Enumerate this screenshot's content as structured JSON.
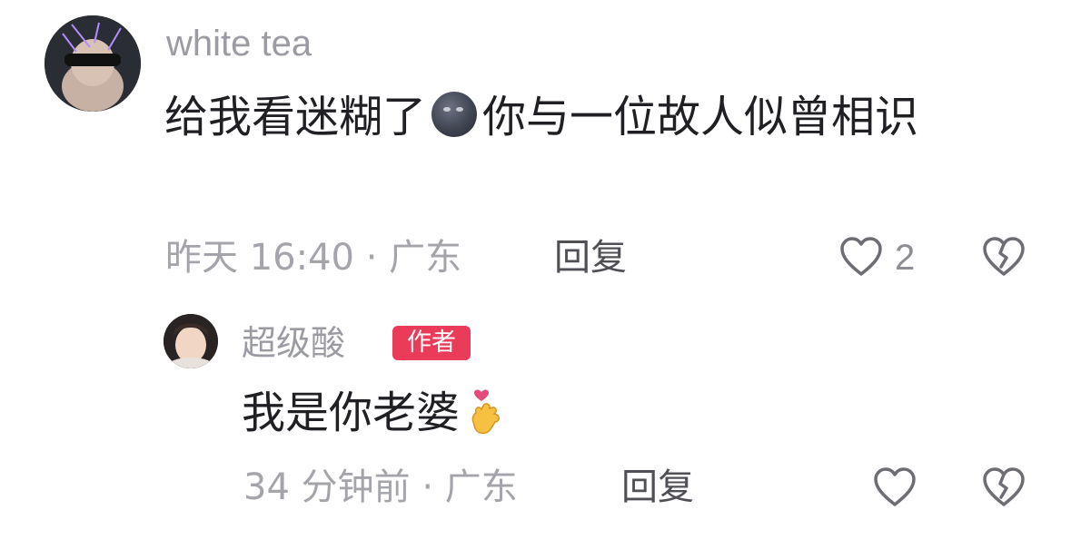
{
  "comment": {
    "username": "white tea",
    "text_before_emoji": "给我看迷糊了",
    "emoji": "new-moon-face-emoji",
    "text_after_emoji": "你与一位故人似曾相识",
    "time_location": "昨天 16:40 · 广东",
    "reply_label": "回复",
    "like_count": "2"
  },
  "reply": {
    "username": "超级酸",
    "badge": "作者",
    "text": "我是你老婆",
    "emoji": "heart-hands-emoji",
    "time_location": "34 分钟前 · 广东",
    "reply_label": "回复"
  },
  "colors": {
    "badge": "#ea3b59",
    "muted_text": "#a4a4ab",
    "body_text": "#1f1f24"
  }
}
